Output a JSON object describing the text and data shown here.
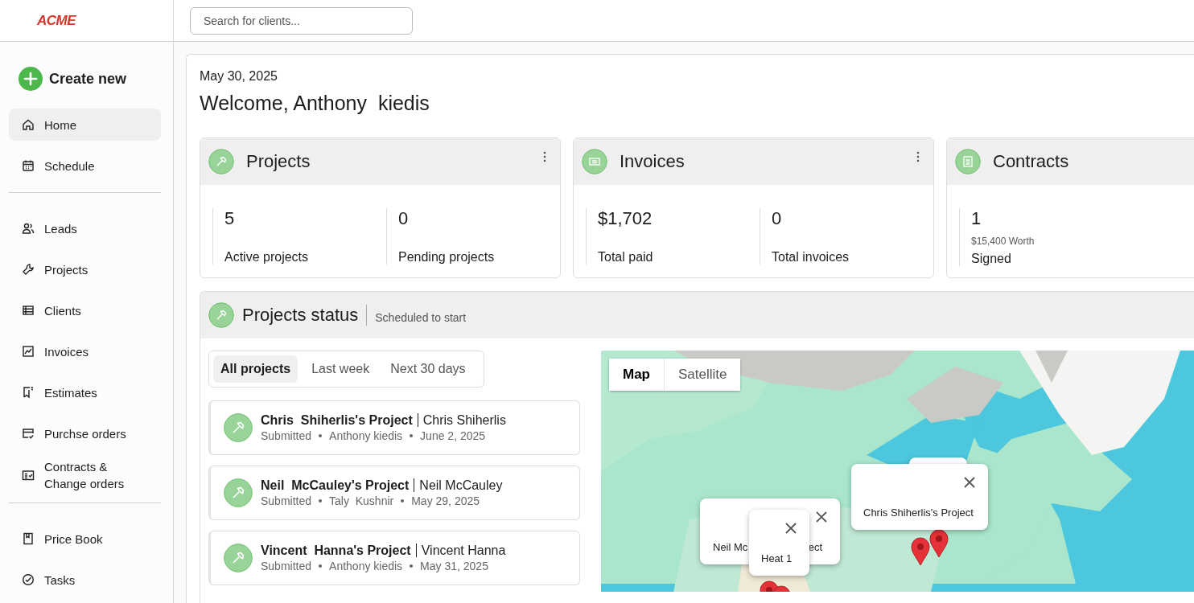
{
  "logo": "ACME",
  "search": {
    "placeholder": "Search for clients..."
  },
  "create_button": "Create new",
  "sidebar": {
    "groups": [
      [
        {
          "label": "Home",
          "kind": "home",
          "selected": true
        },
        {
          "label": "Schedule",
          "kind": "calendar",
          "selected": false
        }
      ],
      [
        {
          "label": "Leads",
          "kind": "people",
          "selected": false
        },
        {
          "label": "Projects",
          "kind": "wrench",
          "selected": false
        },
        {
          "label": "Clients",
          "kind": "list",
          "selected": false
        },
        {
          "label": "Invoices",
          "kind": "chart",
          "selected": false
        },
        {
          "label": "Estimates",
          "kind": "flag",
          "selected": false
        },
        {
          "label": "Purchse orders",
          "kind": "card",
          "selected": false
        },
        {
          "label": "Contracts & Change orders",
          "kind": "contract",
          "selected": false
        }
      ],
      [
        {
          "label": "Price Book",
          "kind": "book",
          "selected": false
        },
        {
          "label": "Tasks",
          "kind": "check",
          "selected": false
        }
      ]
    ]
  },
  "date": "May 30, 2025",
  "welcome": "Welcome, Anthony  kiedis",
  "summary_cards": [
    {
      "title": "Projects",
      "kind": "hammer",
      "menu": true,
      "stats": [
        {
          "value": "5",
          "label": "Active projects"
        },
        {
          "value": "0",
          "label": "Pending projects"
        }
      ]
    },
    {
      "title": "Invoices",
      "kind": "invoice",
      "menu": true,
      "stats": [
        {
          "value": "$1,702",
          "label": "Total paid"
        },
        {
          "value": "0",
          "label": "Total invoices"
        }
      ]
    },
    {
      "title": "Contracts",
      "kind": "document",
      "menu": false,
      "stats": [
        {
          "value": "1",
          "note": "$15,400 Worth",
          "label": "Signed"
        }
      ]
    }
  ],
  "projects_status": {
    "title": "Projects status",
    "subtitle": "Scheduled to start",
    "filters": [
      {
        "label": "All projects",
        "selected": true
      },
      {
        "label": "Last week",
        "selected": false
      },
      {
        "label": "Next 30 days",
        "selected": false
      }
    ],
    "projects": [
      {
        "name": "Chris  Shiherlis's Project",
        "client": "Chris Shiherlis",
        "status": "Submitted",
        "owner": "Anthony kiedis",
        "date": "June 2, 2025"
      },
      {
        "name": "Neil  McCauley's Project",
        "client": "Neil McCauley",
        "status": "Submitted",
        "owner": "Taly  Kushnir",
        "date": "May 29, 2025"
      },
      {
        "name": "Vincent  Hanna's Project",
        "client": "Vincent Hanna",
        "status": "Submitted",
        "owner": "Anthony kiedis",
        "date": "May 31, 2025"
      }
    ],
    "map": {
      "types": [
        {
          "label": "Map",
          "selected": true
        },
        {
          "label": "Satellite",
          "selected": false
        }
      ],
      "popups": [
        {
          "kind": "blank"
        },
        {
          "kind": "split",
          "parts": [
            "Neil Mc",
            "ect"
          ]
        },
        {
          "kind": "text",
          "text": "Heat 1"
        },
        {
          "kind": "text",
          "text": "Chris Shiherlis's Project"
        }
      ]
    }
  }
}
